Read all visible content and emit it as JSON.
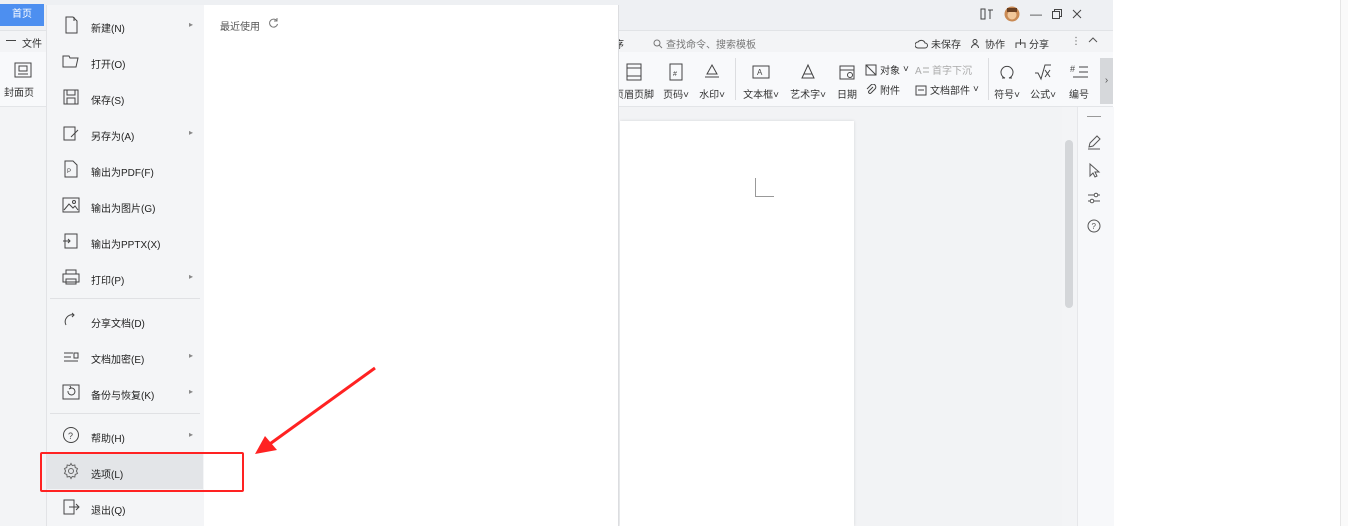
{
  "titlebar": {
    "home_tab": "首页"
  },
  "file_menu_label": "文件",
  "cover_page_button": "封面页",
  "search": {
    "placeholder": "查找命令、搜索模板"
  },
  "partial_tab": "序",
  "actions": {
    "unsaved": "未保存",
    "collaborate": "协作",
    "share": "分享"
  },
  "toolbar": {
    "header_footer": "页眉页脚",
    "page_number": "页码",
    "watermark": "水印",
    "textbox": "文本框",
    "wordart": "艺术字",
    "date": "日期",
    "object": "对象",
    "drop_cap": "首字下沉",
    "attachment": "附件",
    "doc_parts": "文档部件",
    "symbol": "符号",
    "formula": "公式",
    "numbering": "编号"
  },
  "menu": {
    "items": [
      {
        "label": "新建(N)",
        "icon": "new-doc-icon",
        "has_submenu": true
      },
      {
        "label": "打开(O)",
        "icon": "open-folder-icon",
        "has_submenu": false
      },
      {
        "label": "保存(S)",
        "icon": "save-icon",
        "has_submenu": false
      },
      {
        "label": "另存为(A)",
        "icon": "save-as-icon",
        "has_submenu": true
      },
      {
        "label": "输出为PDF(F)",
        "icon": "pdf-icon",
        "has_submenu": false
      },
      {
        "label": "输出为图片(G)",
        "icon": "image-icon",
        "has_submenu": false
      },
      {
        "label": "输出为PPTX(X)",
        "icon": "pptx-icon",
        "has_submenu": false
      },
      {
        "label": "打印(P)",
        "icon": "print-icon",
        "has_submenu": true
      },
      {
        "label": "分享文档(D)",
        "icon": "share-icon",
        "has_submenu": false
      },
      {
        "label": "文档加密(E)",
        "icon": "encrypt-icon",
        "has_submenu": true
      },
      {
        "label": "备份与恢复(K)",
        "icon": "backup-icon",
        "has_submenu": true
      },
      {
        "label": "帮助(H)",
        "icon": "help-icon",
        "has_submenu": true
      },
      {
        "label": "选项(L)",
        "icon": "settings-gear-icon",
        "has_submenu": false,
        "selected": true
      },
      {
        "label": "退出(Q)",
        "icon": "exit-icon",
        "has_submenu": false
      }
    ]
  },
  "recent": {
    "label": "最近使用"
  },
  "colors": {
    "accent": "#4d8ff0",
    "highlight": "#ff2222"
  }
}
